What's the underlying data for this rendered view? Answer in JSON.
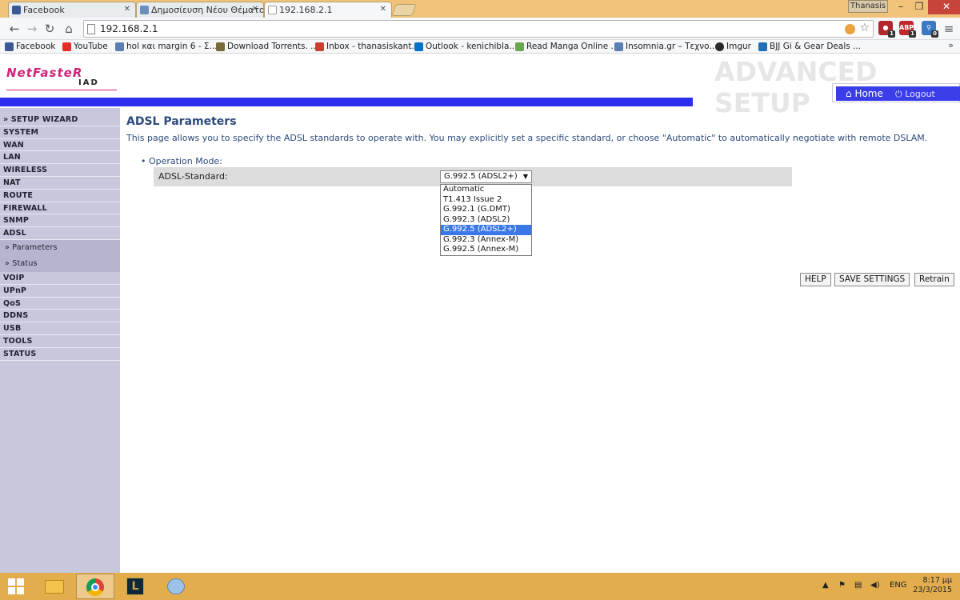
{
  "browser": {
    "tabs": [
      {
        "title": "Facebook",
        "color": "#3b5998"
      },
      {
        "title": "Δημοσίευση Νέου Θέματο",
        "color": "#6a8fbf"
      },
      {
        "title": "192.168.2.1",
        "color": "#e9ecef"
      }
    ],
    "profile": "Thanasis",
    "window_controls": {
      "minimize": "–",
      "restore": "❐",
      "close": "✕"
    },
    "url": "192.168.2.1",
    "extensions": [
      {
        "icon": "ghostery-icon",
        "count": "1",
        "color": "#b3282d"
      },
      {
        "icon": "adblock-icon",
        "label": "ABP",
        "count": "1",
        "color": "#c0272d"
      },
      {
        "icon": "extension-icon",
        "count": "0",
        "color": "#3a7ac2"
      }
    ],
    "bookmarks": [
      {
        "label": "Facebook",
        "color": "#3b5998"
      },
      {
        "label": "YouTube",
        "color": "#e52d27"
      },
      {
        "label": "hol και margin 6 - Σ...",
        "color": "#5b7fb3"
      },
      {
        "label": "Download Torrents. ...",
        "color": "#7a6a3a"
      },
      {
        "label": "Inbox - thanasiskant...",
        "color": "#c94033"
      },
      {
        "label": "Outlook - kenichibla...",
        "color": "#0072c6"
      },
      {
        "label": "Read Manga Online ...",
        "color": "#6aa84f"
      },
      {
        "label": "Insomnia.gr – Τεχνο...",
        "color": "#5b7fb3"
      },
      {
        "label": "Imgur",
        "color": "#2b2b2b"
      },
      {
        "label": "BJJ Gi & Gear Deals ...",
        "color": "#1f6fb2"
      }
    ],
    "bookmarks_more": "»"
  },
  "router": {
    "logo_brand": "NetFasteR",
    "logo_sub": "IAD",
    "banner": "ADVANCED SETUP",
    "home": "Home",
    "logout": "Logout",
    "sidebar": [
      "» SETUP WIZARD",
      "SYSTEM",
      "WAN",
      "LAN",
      "WIRELESS",
      "NAT",
      "ROUTE",
      "FIREWALL",
      "SNMP",
      "ADSL"
    ],
    "sidebar_sub": [
      "» Parameters",
      "» Status"
    ],
    "sidebar_after": [
      "VOIP",
      "UPnP",
      "QoS",
      "DDNS",
      "USB",
      "TOOLS",
      "STATUS"
    ],
    "title": "ADSL Parameters",
    "description": "This page allows you to specify the ADSL standards to operate with. You may explicitly set a specific standard, or choose \"Automatic\" to automatically negotiate with remote DSLAM.",
    "operation_mode_label": "• Operation Mode:",
    "adsl_standard_label": "ADSL-Standard:",
    "adsl_standard_value": "G.992.5 (ADSL2+)",
    "adsl_standard_options": [
      "Automatic",
      "T1.413 Issue 2",
      "G.992.1 (G.DMT)",
      "G.992.3 (ADSL2)",
      "G.992.5 (ADSL2+)",
      "G.992.3 (Annex-M)",
      "G.992.5 (Annex-M)"
    ],
    "selected_option_index": 4,
    "buttons": {
      "help": "HELP",
      "save": "SAVE SETTINGS",
      "retrain": "Retrain"
    }
  },
  "taskbar": {
    "apps": [
      "file-explorer-icon",
      "chrome-icon",
      "league-of-legends-icon",
      "paint-icon"
    ],
    "language": "ENG",
    "time": "8:17 μμ",
    "date": "23/3/2015"
  }
}
